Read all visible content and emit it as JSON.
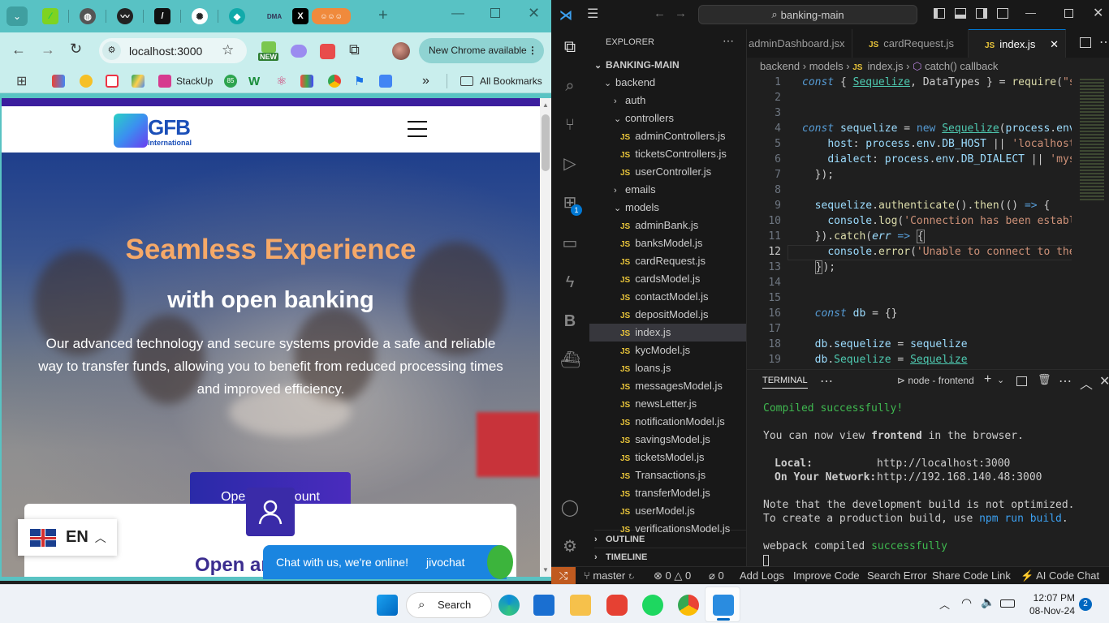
{
  "chrome": {
    "address": "localhost:3000",
    "new_badge": "NEW",
    "update_chip": "New Chrome available",
    "bookmarks": [
      {
        "label": "StackUp"
      },
      {
        "label": "85"
      }
    ],
    "all_bookmarks": "All Bookmarks",
    "chevron": "»"
  },
  "site": {
    "logo_text": "GFB",
    "logo_sub": "International",
    "hero_title": "Seamless Experience",
    "hero_subtitle": "with open banking",
    "hero_text_1": "Our advanced technology and secure systems provide a safe and reliable",
    "hero_text_2": "way to transfer funds, allowing you to benefit from reduced processing times",
    "hero_text_3": "and improved efficiency.",
    "cta": "Open an account",
    "card_heading_partial": "Open ar",
    "lang_code": "EN",
    "chat_label": "Chat with us, we're online!",
    "chat_brand": "jivochat"
  },
  "vscode": {
    "command_center": "banking-main",
    "explorer_title": "EXPLORER",
    "root": "BANKING-MAIN",
    "tree": [
      {
        "label": "backend",
        "type": "folder-open",
        "indent": 1
      },
      {
        "label": "auth",
        "type": "folder",
        "indent": 2
      },
      {
        "label": "controllers",
        "type": "folder-open",
        "indent": 2
      },
      {
        "label": "adminControllers.js",
        "type": "js",
        "indent": 3
      },
      {
        "label": "ticketsControllers.js",
        "type": "js",
        "indent": 3
      },
      {
        "label": "userController.js",
        "type": "js",
        "indent": 3
      },
      {
        "label": "emails",
        "type": "folder",
        "indent": 2
      },
      {
        "label": "models",
        "type": "folder-open",
        "indent": 2
      },
      {
        "label": "adminBank.js",
        "type": "js",
        "indent": 3
      },
      {
        "label": "banksModel.js",
        "type": "js",
        "indent": 3
      },
      {
        "label": "cardRequest.js",
        "type": "js",
        "indent": 3
      },
      {
        "label": "cardsModel.js",
        "type": "js",
        "indent": 3
      },
      {
        "label": "contactModel.js",
        "type": "js",
        "indent": 3
      },
      {
        "label": "depositModel.js",
        "type": "js",
        "indent": 3
      },
      {
        "label": "index.js",
        "type": "js",
        "indent": 3,
        "active": true
      },
      {
        "label": "kycModel.js",
        "type": "js",
        "indent": 3
      },
      {
        "label": "loans.js",
        "type": "js",
        "indent": 3
      },
      {
        "label": "messagesModel.js",
        "type": "js",
        "indent": 3
      },
      {
        "label": "newsLetter.js",
        "type": "js",
        "indent": 3
      },
      {
        "label": "notificationModel.js",
        "type": "js",
        "indent": 3
      },
      {
        "label": "savingsModel.js",
        "type": "js",
        "indent": 3
      },
      {
        "label": "ticketsModel.js",
        "type": "js",
        "indent": 3
      },
      {
        "label": "Transactions.js",
        "type": "js",
        "indent": 3
      },
      {
        "label": "transferModel.js",
        "type": "js",
        "indent": 3
      },
      {
        "label": "userModel.js",
        "type": "js",
        "indent": 3
      },
      {
        "label": "verificationsModel.js",
        "type": "js",
        "indent": 3
      }
    ],
    "outline": "OUTLINE",
    "timeline": "TIMELINE",
    "tabs": [
      {
        "label": "adminDashboard.jsx"
      },
      {
        "label": "cardRequest.js"
      },
      {
        "label": "index.js",
        "active": true
      }
    ],
    "breadcrumbs": [
      "backend",
      "models",
      "index.js",
      "catch() callback"
    ],
    "line_numbers": [
      "1",
      "2",
      "3",
      "4",
      "5",
      "6",
      "7",
      "8",
      "9",
      "10",
      "11",
      "12",
      "13",
      "14",
      "15",
      "16",
      "17",
      "18",
      "19"
    ],
    "terminal": {
      "tab": "TERMINAL",
      "shell": "node - frontend",
      "compiled": "Compiled successfully!",
      "view_prefix": "You can now view ",
      "app": "frontend",
      "view_suffix": " in the browser.",
      "local_label": "Local:",
      "local_url": "http://localhost:3000",
      "network_label": "On Your Network:",
      "network_url": "http://192.168.140.48:3000",
      "note1": "Note that the development build is not optimized.",
      "note2_prefix": "To create a production build, use ",
      "note2_cmd": "npm run build",
      "note2_suffix": ".",
      "webpack_prefix": "webpack compiled ",
      "webpack_status": "successfully"
    },
    "status": {
      "branch": "master",
      "errors": "0",
      "warnings": "0",
      "ports": "0",
      "items": [
        "Add Logs",
        "Improve Code",
        "Search Error",
        "Share Code Link",
        "AI Code Chat"
      ]
    },
    "extensions_badge": "1"
  },
  "taskbar": {
    "search": "Search",
    "time": "12:07 PM",
    "date": "08-Nov-24",
    "notification_count": "2"
  }
}
